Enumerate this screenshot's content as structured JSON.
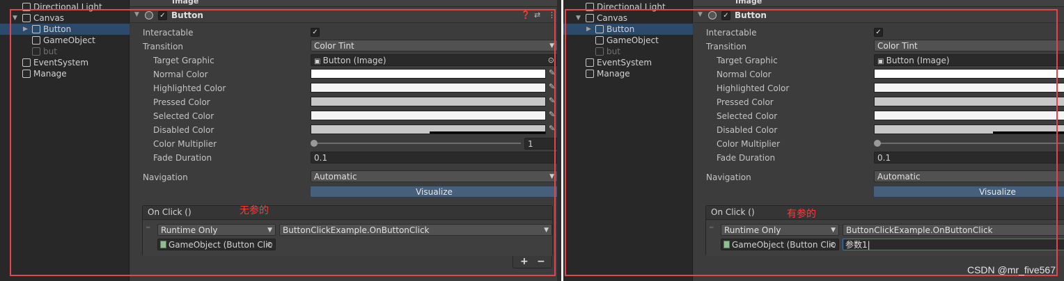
{
  "hierarchy": {
    "items": [
      {
        "label": "Directional Light"
      },
      {
        "label": "Canvas"
      },
      {
        "label": "Button"
      },
      {
        "label": "GameObject"
      },
      {
        "label": "but"
      },
      {
        "label": "EventSystem"
      },
      {
        "label": "Manage"
      }
    ]
  },
  "inspector": {
    "image_header": "Image",
    "component_title": "Button",
    "props": {
      "interactable_label": "Interactable",
      "interactable_checked": true,
      "transition_label": "Transition",
      "transition_value": "Color Tint",
      "target_graphic_label": "Target Graphic",
      "target_graphic_value": "Button (Image)",
      "normal_color_label": "Normal Color",
      "highlighted_color_label": "Highlighted Color",
      "pressed_color_label": "Pressed Color",
      "selected_color_label": "Selected Color",
      "disabled_color_label": "Disabled Color",
      "color_multiplier_label": "Color Multiplier",
      "color_multiplier_value": "1",
      "fade_duration_label": "Fade Duration",
      "fade_duration_value": "0.1",
      "navigation_label": "Navigation",
      "navigation_value": "Automatic",
      "visualize_label": "Visualize"
    },
    "colors": {
      "normal": "#ffffff",
      "highlighted": "#f5f5f5",
      "pressed": "#c8c8c8",
      "selected": "#f5f5f5",
      "disabled": "#c8c8c8"
    },
    "onclick": {
      "header": "On Click ()",
      "runtime": "Runtime Only",
      "function": "ButtonClickExample.OnButtonClick",
      "object": "GameObject (Button Clic",
      "param_value": "参数1",
      "add_label": "+",
      "remove_label": "−"
    }
  },
  "annotations": {
    "left": "无参的",
    "right": "有参的"
  },
  "watermark": "CSDN @mr_five567",
  "accent_colors": {
    "annotation_red": "#e8434b",
    "selection_blue": "#2c4a6c",
    "visualize_blue": "#46607c"
  }
}
